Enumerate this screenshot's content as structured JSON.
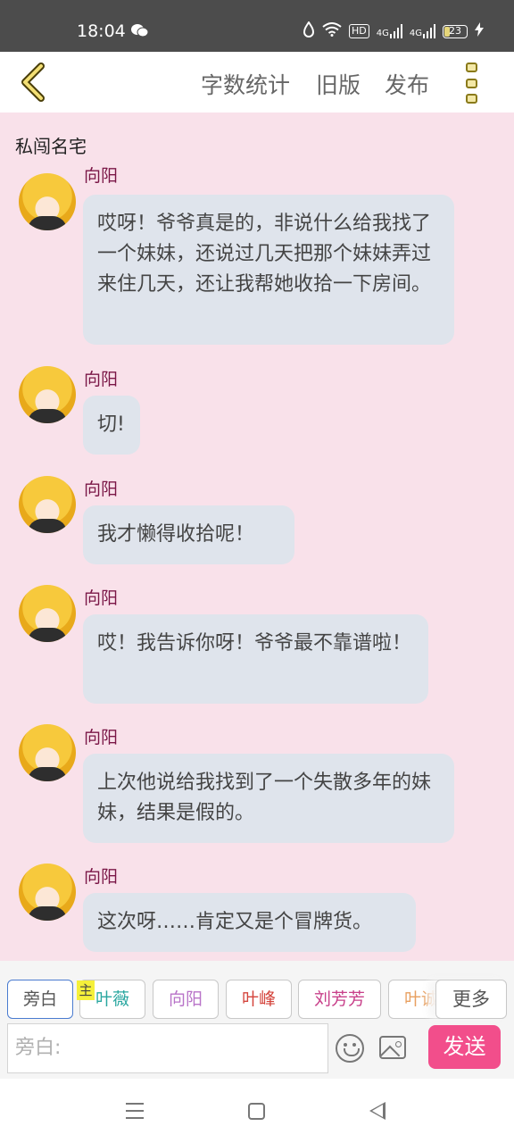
{
  "status_bar": {
    "time": "18:04",
    "wechat_icon": "wechat-icon",
    "hd_label": "HD",
    "signal1_label": "4G",
    "signal2_label": "4G",
    "battery": "23"
  },
  "header": {
    "back_icon": "chevron-left-icon",
    "word_count": "字数统计",
    "old_version": "旧版",
    "publish": "发布",
    "menu_icon": "vertical-menu-icon"
  },
  "chat": {
    "title": "私闯名宅",
    "messages": [
      {
        "sender": "向阳",
        "text": "哎呀！爷爷真是的，非说什么给我找了一个妹妹，还说过几天把那个妹妹弄过来住几天，还让我帮她收拾一下房间。"
      },
      {
        "sender": "向阳",
        "text": "切!"
      },
      {
        "sender": "向阳",
        "text": "我才懒得收拾呢！"
      },
      {
        "sender": "向阳",
        "text": "哎！我告诉你呀！爷爷最不靠谱啦！"
      },
      {
        "sender": "向阳",
        "text": "上次他说给我找到了一个失散多年的妹妹，结果是假的。"
      },
      {
        "sender": "向阳",
        "text": "这次呀……肯定又是个冒牌货。"
      }
    ]
  },
  "roles": {
    "items": [
      {
        "label": "旁白",
        "color": "#555555"
      },
      {
        "label": "叶薇",
        "color": "#2aa7a0"
      },
      {
        "label": "向阳",
        "color": "#b873c8"
      },
      {
        "label": "叶峰",
        "color": "#d4443c"
      },
      {
        "label": "刘芳芳",
        "color": "#c8408a"
      },
      {
        "label": "叶诚",
        "color": "#e8a060"
      }
    ],
    "main_badge": "主",
    "more": "更多"
  },
  "composer": {
    "placeholder": "旁白:",
    "send": "发送"
  },
  "nav_icons": [
    "menu-icon",
    "home-icon",
    "back-icon"
  ]
}
